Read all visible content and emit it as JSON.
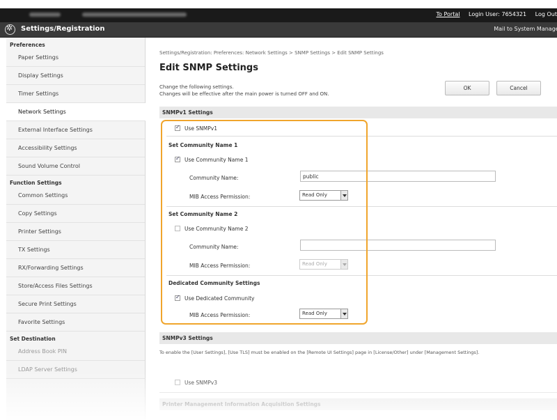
{
  "topbar": {
    "portal_label": "To Portal",
    "login_user": "Login User:  7654321",
    "logout_label": "Log Out"
  },
  "header": {
    "title": "Settings/Registration",
    "mail_label": "Mail to System Manager"
  },
  "sidebar": {
    "groups": [
      {
        "heading": "Preferences",
        "items": [
          "Paper Settings",
          "Display Settings",
          "Timer Settings",
          "Network Settings",
          "External Interface Settings",
          "Accessibility Settings",
          "Sound Volume Control"
        ]
      },
      {
        "heading": "Function Settings",
        "items": [
          "Common Settings",
          "Copy Settings",
          "Printer Settings",
          "TX Settings",
          "RX/Forwarding Settings",
          "Store/Access Files Settings",
          "Secure Print Settings",
          "Favorite Settings"
        ]
      },
      {
        "heading": "Set Destination",
        "items": [
          "Address Book PIN",
          "LDAP Server Settings"
        ]
      }
    ],
    "active_item": "Network Settings"
  },
  "main": {
    "breadcrumb": "Settings/Registration: Preferences: Network Settings > SNMP Settings > Edit SNMP Settings",
    "title": "Edit SNMP Settings",
    "description_line1": "Change the following settings.",
    "description_line2": "Changes will be effective after the main power is turned OFF and ON.",
    "ok_label": "OK",
    "cancel_label": "Cancel",
    "snmpv1": {
      "section_title": "SNMPv1 Settings",
      "use_snmpv1_label": "Use SNMPv1",
      "use_snmpv1_checked": true,
      "community1": {
        "heading": "Set Community Name 1",
        "use_label": "Use Community Name 1",
        "checked": true,
        "name_label": "Community Name:",
        "name_value": "public",
        "permission_label": "MIB Access Permission:",
        "permission_value": "Read Only"
      },
      "community2": {
        "heading": "Set Community Name 2",
        "use_label": "Use Community Name 2",
        "checked": false,
        "name_label": "Community Name:",
        "name_value": "",
        "permission_label": "MIB Access Permission:",
        "permission_value": "Read Only"
      },
      "dedicated": {
        "heading": "Dedicated Community Settings",
        "use_label": "Use Dedicated Community",
        "checked": true,
        "permission_label": "MIB Access Permission:",
        "permission_value": "Read Only"
      }
    },
    "snmpv3": {
      "section_title": "SNMPv3 Settings",
      "note": "To enable the [User Settings], [Use TLS] must be enabled on the [Remote UI Settings] page in [License/Other] under [Management Settings].",
      "use_snmpv3_label": "Use SNMPv3",
      "use_snmpv3_checked": false
    },
    "printer_mgmt_section_title": "Printer Management Information Acquisition Settings"
  },
  "colors": {
    "highlight": "#f0a52c",
    "topbar": "#1a1a1a",
    "header": "#3a3a3a"
  }
}
